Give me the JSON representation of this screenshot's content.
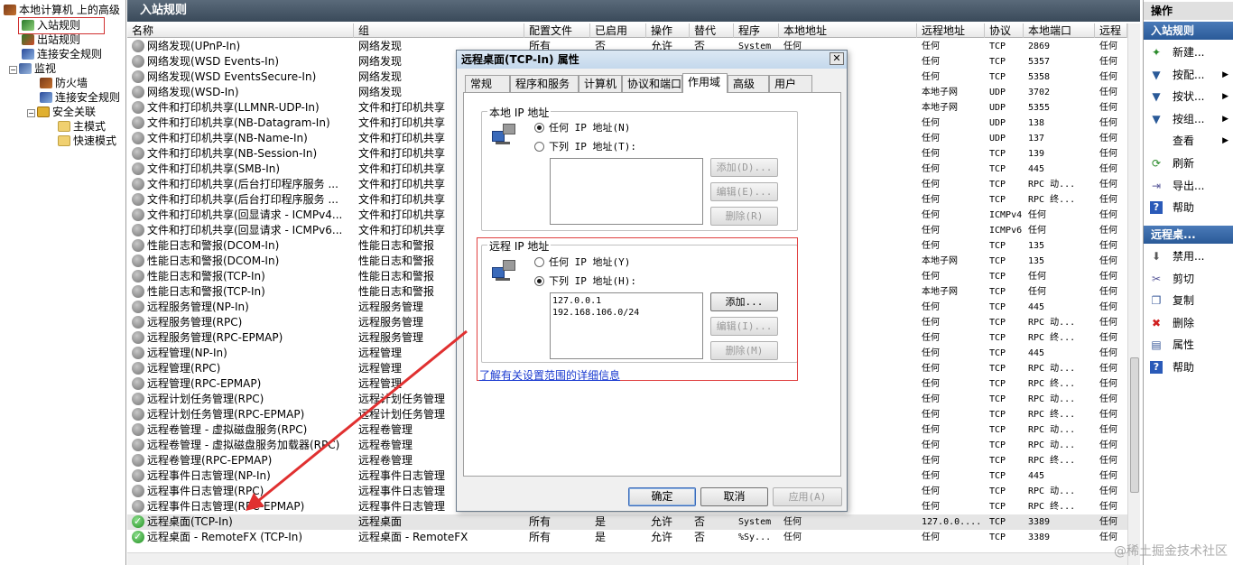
{
  "tree": {
    "root": "本地计算机 上的高级",
    "items": [
      "入站规则",
      "出站规则",
      "连接安全规则",
      "监视",
      "防火墙",
      "连接安全规则",
      "安全关联",
      "主模式",
      "快速模式"
    ]
  },
  "center": {
    "title": "入站规则",
    "columns": [
      "名称",
      "组",
      "配置文件",
      "已启用",
      "操作",
      "替代",
      "程序",
      "本地地址",
      "远程地址",
      "协议",
      "本地端口",
      "远程"
    ],
    "rows": [
      {
        "name": "网络发现(UPnP-In)",
        "group": "网络发现",
        "profile": "所有",
        "enabled": "否",
        "action": "允许",
        "override": "否",
        "program": "System",
        "local": "任何",
        "remote": "任何",
        "proto": "TCP",
        "lport": "2869",
        "rport": "任何",
        "on": false
      },
      {
        "name": "网络发现(WSD Events-In)",
        "group": "网络发现",
        "profile": "",
        "enabled": "",
        "action": "",
        "override": "",
        "program": "",
        "local": "",
        "remote": "任何",
        "proto": "TCP",
        "lport": "5357",
        "rport": "任何",
        "on": false
      },
      {
        "name": "网络发现(WSD EventsSecure-In)",
        "group": "网络发现",
        "profile": "",
        "enabled": "",
        "action": "",
        "override": "",
        "program": "",
        "local": "",
        "remote": "任何",
        "proto": "TCP",
        "lport": "5358",
        "rport": "任何",
        "on": false
      },
      {
        "name": "网络发现(WSD-In)",
        "group": "网络发现",
        "profile": "",
        "enabled": "",
        "action": "",
        "override": "",
        "program": "",
        "local": "",
        "remote": "本地子网",
        "proto": "UDP",
        "lport": "3702",
        "rport": "任何",
        "on": false
      },
      {
        "name": "文件和打印机共享(LLMNR-UDP-In)",
        "group": "文件和打印机共享",
        "profile": "",
        "enabled": "",
        "action": "",
        "override": "",
        "program": "",
        "local": "",
        "remote": "本地子网",
        "proto": "UDP",
        "lport": "5355",
        "rport": "任何",
        "on": false
      },
      {
        "name": "文件和打印机共享(NB-Datagram-In)",
        "group": "文件和打印机共享",
        "profile": "",
        "enabled": "",
        "action": "",
        "override": "",
        "program": "",
        "local": "",
        "remote": "任何",
        "proto": "UDP",
        "lport": "138",
        "rport": "任何",
        "on": false
      },
      {
        "name": "文件和打印机共享(NB-Name-In)",
        "group": "文件和打印机共享",
        "profile": "",
        "enabled": "",
        "action": "",
        "override": "",
        "program": "",
        "local": "",
        "remote": "任何",
        "proto": "UDP",
        "lport": "137",
        "rport": "任何",
        "on": false
      },
      {
        "name": "文件和打印机共享(NB-Session-In)",
        "group": "文件和打印机共享",
        "profile": "",
        "enabled": "",
        "action": "",
        "override": "",
        "program": "",
        "local": "",
        "remote": "任何",
        "proto": "TCP",
        "lport": "139",
        "rport": "任何",
        "on": false
      },
      {
        "name": "文件和打印机共享(SMB-In)",
        "group": "文件和打印机共享",
        "profile": "",
        "enabled": "",
        "action": "",
        "override": "",
        "program": "",
        "local": "",
        "remote": "任何",
        "proto": "TCP",
        "lport": "445",
        "rport": "任何",
        "on": false
      },
      {
        "name": "文件和打印机共享(后台打印程序服务 ...",
        "group": "文件和打印机共享",
        "profile": "",
        "enabled": "",
        "action": "",
        "override": "",
        "program": "",
        "local": "",
        "remote": "任何",
        "proto": "TCP",
        "lport": "RPC 动...",
        "rport": "任何",
        "on": false
      },
      {
        "name": "文件和打印机共享(后台打印程序服务 ...",
        "group": "文件和打印机共享",
        "profile": "",
        "enabled": "",
        "action": "",
        "override": "",
        "program": "",
        "local": "",
        "remote": "任何",
        "proto": "TCP",
        "lport": "RPC 终...",
        "rport": "任何",
        "on": false
      },
      {
        "name": "文件和打印机共享(回显请求 - ICMPv4...",
        "group": "文件和打印机共享",
        "profile": "",
        "enabled": "",
        "action": "",
        "override": "",
        "program": "",
        "local": "",
        "remote": "任何",
        "proto": "ICMPv4",
        "lport": "任何",
        "rport": "任何",
        "on": false
      },
      {
        "name": "文件和打印机共享(回显请求 - ICMPv6...",
        "group": "文件和打印机共享",
        "profile": "",
        "enabled": "",
        "action": "",
        "override": "",
        "program": "",
        "local": "",
        "remote": "任何",
        "proto": "ICMPv6",
        "lport": "任何",
        "rport": "任何",
        "on": false
      },
      {
        "name": "性能日志和警报(DCOM-In)",
        "group": "性能日志和警报",
        "profile": "",
        "enabled": "",
        "action": "",
        "override": "",
        "program": "",
        "local": "",
        "remote": "任何",
        "proto": "TCP",
        "lport": "135",
        "rport": "任何",
        "on": false
      },
      {
        "name": "性能日志和警报(DCOM-In)",
        "group": "性能日志和警报",
        "profile": "",
        "enabled": "",
        "action": "",
        "override": "",
        "program": "",
        "local": "",
        "remote": "本地子网",
        "proto": "TCP",
        "lport": "135",
        "rport": "任何",
        "on": false
      },
      {
        "name": "性能日志和警报(TCP-In)",
        "group": "性能日志和警报",
        "profile": "",
        "enabled": "",
        "action": "",
        "override": "",
        "program": "",
        "local": "",
        "remote": "任何",
        "proto": "TCP",
        "lport": "任何",
        "rport": "任何",
        "on": false
      },
      {
        "name": "性能日志和警报(TCP-In)",
        "group": "性能日志和警报",
        "profile": "",
        "enabled": "",
        "action": "",
        "override": "",
        "program": "",
        "local": "",
        "remote": "本地子网",
        "proto": "TCP",
        "lport": "任何",
        "rport": "任何",
        "on": false
      },
      {
        "name": "远程服务管理(NP-In)",
        "group": "远程服务管理",
        "profile": "",
        "enabled": "",
        "action": "",
        "override": "",
        "program": "",
        "local": "",
        "remote": "任何",
        "proto": "TCP",
        "lport": "445",
        "rport": "任何",
        "on": false
      },
      {
        "name": "远程服务管理(RPC)",
        "group": "远程服务管理",
        "profile": "",
        "enabled": "",
        "action": "",
        "override": "",
        "program": "",
        "local": "",
        "remote": "任何",
        "proto": "TCP",
        "lport": "RPC 动...",
        "rport": "任何",
        "on": false
      },
      {
        "name": "远程服务管理(RPC-EPMAP)",
        "group": "远程服务管理",
        "profile": "",
        "enabled": "",
        "action": "",
        "override": "",
        "program": "",
        "local": "",
        "remote": "任何",
        "proto": "TCP",
        "lport": "RPC 终...",
        "rport": "任何",
        "on": false
      },
      {
        "name": "远程管理(NP-In)",
        "group": "远程管理",
        "profile": "",
        "enabled": "",
        "action": "",
        "override": "",
        "program": "",
        "local": "",
        "remote": "任何",
        "proto": "TCP",
        "lport": "445",
        "rport": "任何",
        "on": false
      },
      {
        "name": "远程管理(RPC)",
        "group": "远程管理",
        "profile": "",
        "enabled": "",
        "action": "",
        "override": "",
        "program": "",
        "local": "",
        "remote": "任何",
        "proto": "TCP",
        "lport": "RPC 动...",
        "rport": "任何",
        "on": false
      },
      {
        "name": "远程管理(RPC-EPMAP)",
        "group": "远程管理",
        "profile": "",
        "enabled": "",
        "action": "",
        "override": "",
        "program": "",
        "local": "",
        "remote": "任何",
        "proto": "TCP",
        "lport": "RPC 终...",
        "rport": "任何",
        "on": false
      },
      {
        "name": "远程计划任务管理(RPC)",
        "group": "远程计划任务管理",
        "profile": "",
        "enabled": "",
        "action": "",
        "override": "",
        "program": "",
        "local": "",
        "remote": "任何",
        "proto": "TCP",
        "lport": "RPC 动...",
        "rport": "任何",
        "on": false
      },
      {
        "name": "远程计划任务管理(RPC-EPMAP)",
        "group": "远程计划任务管理",
        "profile": "",
        "enabled": "",
        "action": "",
        "override": "",
        "program": "",
        "local": "",
        "remote": "任何",
        "proto": "TCP",
        "lport": "RPC 终...",
        "rport": "任何",
        "on": false
      },
      {
        "name": "远程卷管理 - 虚拟磁盘服务(RPC)",
        "group": "远程卷管理",
        "profile": "",
        "enabled": "",
        "action": "",
        "override": "",
        "program": "",
        "local": "",
        "remote": "任何",
        "proto": "TCP",
        "lport": "RPC 动...",
        "rport": "任何",
        "on": false
      },
      {
        "name": "远程卷管理 - 虚拟磁盘服务加载器(RPC)",
        "group": "远程卷管理",
        "profile": "",
        "enabled": "",
        "action": "",
        "override": "",
        "program": "",
        "local": "",
        "remote": "任何",
        "proto": "TCP",
        "lport": "RPC 动...",
        "rport": "任何",
        "on": false
      },
      {
        "name": "远程卷管理(RPC-EPMAP)",
        "group": "远程卷管理",
        "profile": "",
        "enabled": "",
        "action": "",
        "override": "",
        "program": "",
        "local": "",
        "remote": "任何",
        "proto": "TCP",
        "lport": "RPC 终...",
        "rport": "任何",
        "on": false
      },
      {
        "name": "远程事件日志管理(NP-In)",
        "group": "远程事件日志管理",
        "profile": "",
        "enabled": "",
        "action": "",
        "override": "",
        "program": "",
        "local": "",
        "remote": "任何",
        "proto": "TCP",
        "lport": "445",
        "rport": "任何",
        "on": false
      },
      {
        "name": "远程事件日志管理(RPC)",
        "group": "远程事件日志管理",
        "profile": "",
        "enabled": "",
        "action": "",
        "override": "",
        "program": "",
        "local": "",
        "remote": "任何",
        "proto": "TCP",
        "lport": "RPC 动...",
        "rport": "任何",
        "on": false
      },
      {
        "name": "远程事件日志管理(RPC-EPMAP)",
        "group": "远程事件日志管理",
        "profile": "",
        "enabled": "",
        "action": "",
        "override": "",
        "program": "",
        "local": "",
        "remote": "任何",
        "proto": "TCP",
        "lport": "RPC 终...",
        "rport": "任何",
        "on": false
      },
      {
        "name": "远程桌面(TCP-In)",
        "group": "远程桌面",
        "profile": "所有",
        "enabled": "是",
        "action": "允许",
        "override": "否",
        "program": "System",
        "local": "任何",
        "remote": "127.0.0....",
        "proto": "TCP",
        "lport": "3389",
        "rport": "任何",
        "on": true
      },
      {
        "name": "远程桌面 - RemoteFX (TCP-In)",
        "group": "远程桌面 - RemoteFX",
        "profile": "所有",
        "enabled": "是",
        "action": "允许",
        "override": "否",
        "program": "%Sy...",
        "local": "任何",
        "remote": "任何",
        "proto": "TCP",
        "lport": "3389",
        "rport": "任何",
        "on": true
      }
    ]
  },
  "actions": {
    "header": "操作",
    "section1": "入站规则",
    "items1": [
      {
        "label": "新建...",
        "icon": "new-rule-icon",
        "glyph": "✦",
        "arrow": false
      },
      {
        "label": "按配...",
        "icon": "filter-icon",
        "glyph": "▼",
        "arrow": true
      },
      {
        "label": "按状...",
        "icon": "filter-icon",
        "glyph": "▼",
        "arrow": true
      },
      {
        "label": "按组...",
        "icon": "filter-icon",
        "glyph": "▼",
        "arrow": true
      },
      {
        "label": "查看",
        "icon": "view-icon",
        "glyph": "",
        "arrow": true
      },
      {
        "label": "刷新",
        "icon": "refresh-icon",
        "glyph": "⟳",
        "arrow": false
      },
      {
        "label": "导出...",
        "icon": "export-icon",
        "glyph": "⇥",
        "arrow": false
      },
      {
        "label": "帮助",
        "icon": "help-icon",
        "glyph": "?",
        "arrow": false
      }
    ],
    "section2": "远程桌...",
    "items2": [
      {
        "label": "禁用...",
        "icon": "disable-icon",
        "glyph": "⬇",
        "arrow": false
      },
      {
        "label": "剪切",
        "icon": "cut-icon",
        "glyph": "✂",
        "arrow": false
      },
      {
        "label": "复制",
        "icon": "copy-icon",
        "glyph": "❐",
        "arrow": false
      },
      {
        "label": "删除",
        "icon": "delete-icon",
        "glyph": "✖",
        "arrow": false
      },
      {
        "label": "属性",
        "icon": "properties-icon",
        "glyph": "▤",
        "arrow": false
      },
      {
        "label": "帮助",
        "icon": "help-icon",
        "glyph": "?",
        "arrow": false
      }
    ]
  },
  "dialog": {
    "title": "远程桌面(TCP-In) 属性",
    "tabs": [
      "常规",
      "程序和服务",
      "计算机",
      "协议和端口",
      "作用域",
      "高级",
      "用户"
    ],
    "local_group": "本地 IP 地址",
    "local_any": "任何 IP 地址(N)",
    "local_list": "下列 IP 地址(T):",
    "local_add": "添加(D)...",
    "local_edit": "编辑(E)...",
    "local_delete": "删除(R)",
    "remote_group": "远程 IP 地址",
    "remote_any": "任何 IP 地址(Y)",
    "remote_list": "下列 IP 地址(H):",
    "remote_items": [
      "127.0.0.1",
      "192.168.106.0/24"
    ],
    "remote_add": "添加...",
    "remote_edit": "编辑(I)...",
    "remote_delete": "删除(M)",
    "link": "了解有关设置范围的详细信息",
    "ok": "确定",
    "cancel": "取消",
    "apply": "应用(A)"
  },
  "watermark": "@稀土掘金技术社区",
  "colors": {
    "accent": "#2a5a98",
    "highlight": "#d03030",
    "arrow": "#e03030"
  }
}
